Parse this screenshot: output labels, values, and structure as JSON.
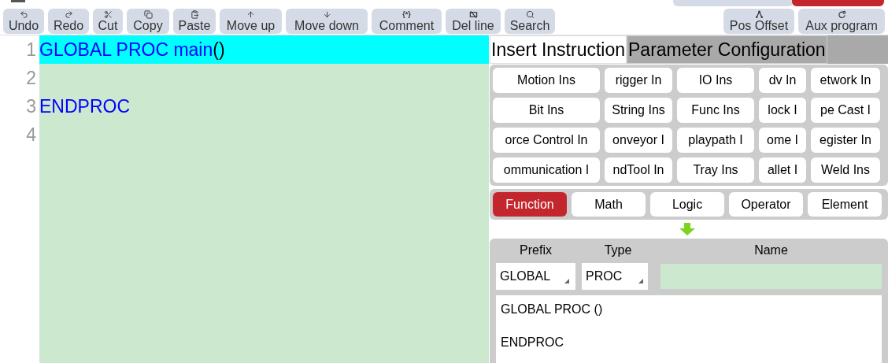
{
  "toolbar": [
    {
      "kind": "undo",
      "label": "Undo"
    },
    {
      "kind": "redo",
      "label": "Redo"
    },
    {
      "kind": "cut",
      "label": "Cut"
    },
    {
      "kind": "copy",
      "label": "Copy"
    },
    {
      "kind": "paste",
      "label": "Paste"
    },
    {
      "kind": "up",
      "label": "Move up"
    },
    {
      "kind": "down",
      "label": "Move down"
    },
    {
      "kind": "text",
      "icon_text": "{*}",
      "label": "Comment"
    },
    {
      "kind": "delline",
      "label": "Del line"
    },
    {
      "kind": "search",
      "label": "Search"
    }
  ],
  "toolbar_right": [
    {
      "kind": "offset",
      "label": "Pos Offset"
    },
    {
      "kind": "aux",
      "label": "Aux program"
    }
  ],
  "editor": {
    "lines": [
      {
        "number": "1",
        "selected": true,
        "tokens": [
          {
            "text": "GLOBAL PROC main",
            "kind": "keyword"
          },
          {
            "text": "()",
            "kind": "punct"
          }
        ]
      },
      {
        "number": "2",
        "selected": false
      },
      {
        "number": "3",
        "selected": false,
        "tokens": [
          {
            "text": "ENDPROC",
            "kind": "keyword"
          }
        ]
      },
      {
        "number": "4",
        "selected": false
      }
    ]
  },
  "tabs": [
    {
      "label": "Insert Instruction",
      "selected": true
    },
    {
      "label": "Parameter Configuration",
      "selected": false
    }
  ],
  "instructions": [
    [
      "Motion Ins",
      "rigger In",
      "IO Ins",
      "dv In",
      "etwork In"
    ],
    [
      "Bit Ins",
      "String Ins",
      "Func Ins",
      "lock I",
      "pe Cast I"
    ],
    [
      "orce Control In",
      "onveyor I",
      "playpath I",
      "ome I",
      "egister In"
    ],
    [
      "ommunication I",
      "ndTool In",
      "Tray Ins",
      "allet I",
      "Weld Ins"
    ]
  ],
  "categories": [
    {
      "label": "Function",
      "selected": true
    },
    {
      "label": "Math",
      "selected": false
    },
    {
      "label": "Logic",
      "selected": false
    },
    {
      "label": "Operator",
      "selected": false
    },
    {
      "label": "Element",
      "selected": false
    }
  ],
  "form": {
    "headers": [
      "Prefix",
      "Type",
      "Name"
    ],
    "prefix": "GLOBAL",
    "type": "PROC",
    "preview": [
      "GLOBAL PROC ()",
      "ENDPROC"
    ]
  }
}
